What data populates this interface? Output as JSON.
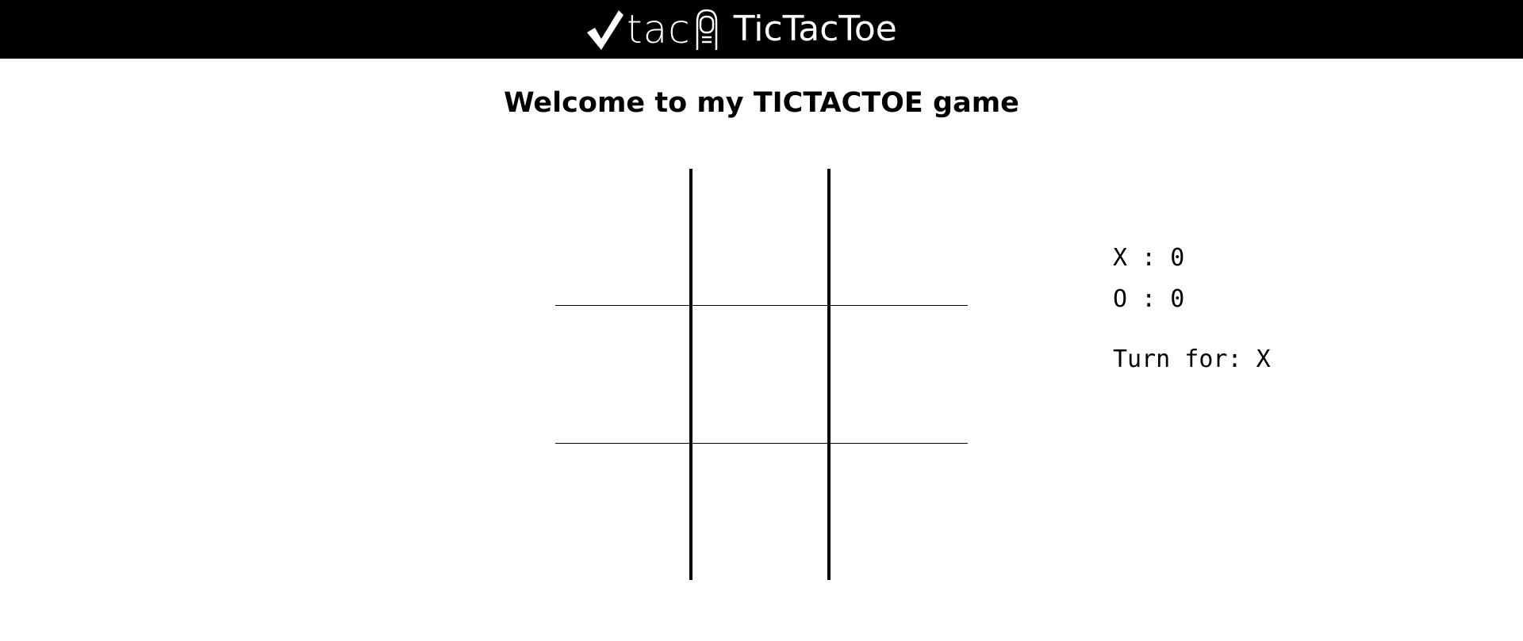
{
  "navbar": {
    "logo_word": "tac",
    "title": "TicTacToe",
    "icons": [
      "check-icon",
      "bottle-icon"
    ]
  },
  "heading": "Welcome to my TICTACTOE game",
  "board": {
    "cells": [
      "",
      "",
      "",
      "",
      "",
      "",
      "",
      "",
      ""
    ]
  },
  "scores": {
    "x_label": "X",
    "x_score": "0",
    "o_label": "O",
    "o_score": "0",
    "separator": ":"
  },
  "turn": {
    "label": "Turn for:",
    "player": "X"
  },
  "colors": {
    "navbar_bg": "#000000",
    "page_bg": "#ffffff",
    "text": "#000000",
    "navbar_text": "#ffffff"
  }
}
